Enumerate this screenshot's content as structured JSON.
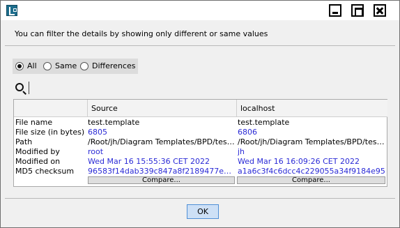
{
  "window": {
    "icon": "app-logo-icon",
    "controls": [
      "minimize-icon",
      "maximize-icon",
      "close-icon"
    ]
  },
  "info_text": "You can filter the details by showing only different or same values",
  "filter": {
    "options": [
      {
        "label": "All",
        "checked": true
      },
      {
        "label": "Same",
        "checked": false
      },
      {
        "label": "Differences",
        "checked": false
      }
    ]
  },
  "search": {
    "value": "",
    "placeholder": "",
    "icon": "search-icon"
  },
  "table": {
    "headers": [
      "",
      "Source",
      "localhost"
    ],
    "rows": [
      {
        "label": "File name",
        "source": "test.template",
        "target": "test.template",
        "highlight": false
      },
      {
        "label": "File size (in bytes)",
        "source": "6805",
        "target": "6806",
        "highlight": true
      },
      {
        "label": "Path",
        "source": "/Root/jh/Diagram Templates/BPD/test...",
        "target": "/Root/jh/Diagram Templates/BPD/test...",
        "highlight": false
      },
      {
        "label": "Modified by",
        "source": "root",
        "target": "jh",
        "highlight": true
      },
      {
        "label": "Modified on",
        "source": "Wed Mar 16 15:55:36 CET 2022",
        "target": "Wed Mar 16 16:09:26 CET 2022",
        "highlight": true
      },
      {
        "label": "MD5 checksum",
        "source": "96583f14dab339c847a8f2189477e9...",
        "target": "a1a6c3f4c6dcc4c229055a34f9184e95",
        "highlight": true
      }
    ],
    "compare_label": "Compare..."
  },
  "ok_label": "OK",
  "colors": {
    "diff_text": "#2a2ad6",
    "ok_button_bg": "#cde0f6",
    "ok_button_border": "#4f8fd6"
  }
}
